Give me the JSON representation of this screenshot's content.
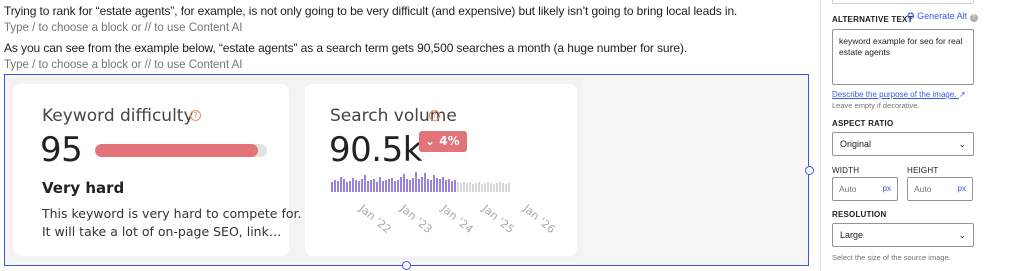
{
  "editor": {
    "paragraph_1": "Trying to rank for “estate agents”, for example, is not only going to be very difficult (and expensive) but likely isn’t going to bring local leads in.",
    "placeholder_1": "Type / to choose a block or // to use Content AI",
    "paragraph_2": "As you can see from the example below, “estate agents” as a search term gets 90,500 searches a month (a huge number for sure).",
    "placeholder_2": "Type / to choose a block or // to use Content AI"
  },
  "image": {
    "difficulty_card": {
      "title": "Keyword difficulty",
      "value": "95",
      "bar_fill_percent": 95,
      "bar_color": "#e27479",
      "level": "Very hard",
      "description_line_1": "This keyword is very hard to compete for.",
      "description_line_2": "It will take a lot of on-page SEO, link…"
    },
    "volume_card": {
      "title": "Search volume",
      "value": "90.5k",
      "trend": "4%",
      "trend_icon": "chevron-down-icon",
      "bar_color": "#9a83dd",
      "faded_bar_color": "#d6d6d6",
      "x_ticks": [
        "Jan '22",
        "Jan '23",
        "Jan '24",
        "Jan '25",
        "Jan '26"
      ],
      "relative_volumes": [
        0.45,
        0.55,
        0.5,
        0.7,
        0.6,
        0.45,
        0.5,
        0.65,
        0.55,
        0.5,
        0.6,
        0.75,
        0.5,
        0.55,
        0.6,
        0.45,
        0.7,
        0.5,
        0.55,
        0.6,
        0.65,
        0.5,
        0.55,
        0.7,
        0.8,
        0.6,
        0.55,
        0.65,
        0.9,
        0.6,
        0.7,
        0.85,
        0.6,
        0.55,
        0.75,
        0.65,
        0.6,
        0.7,
        0.55,
        0.6,
        0.5,
        0.55,
        0.45,
        0.4,
        0.45,
        0.4,
        0.45,
        0.35,
        0.4,
        0.45,
        0.35,
        0.4,
        0.45,
        0.4,
        0.35,
        0.4,
        0.45,
        0.4,
        0.35,
        0.4
      ]
    }
  },
  "sidebar": {
    "alt_text_label": "ALTERNATIVE TEXT",
    "generate_alt": "Generate Alt",
    "alt_text_value": "keyword example for seo for real estate agents",
    "describe_link": "Describe the purpose of the image.",
    "describe_link_icon": "external-link-icon",
    "leave_empty_help": "Leave empty if decorative.",
    "aspect_ratio_label": "ASPECT RATIO",
    "aspect_ratio_value": "Original",
    "width_label": "WIDTH",
    "height_label": "HEIGHT",
    "width_placeholder": "Auto",
    "height_placeholder": "Auto",
    "unit": "px",
    "resolution_label": "RESOLUTION",
    "resolution_value": "Large",
    "resolution_help": "Select the size of the source image.",
    "accent_color": "#3858e9"
  }
}
